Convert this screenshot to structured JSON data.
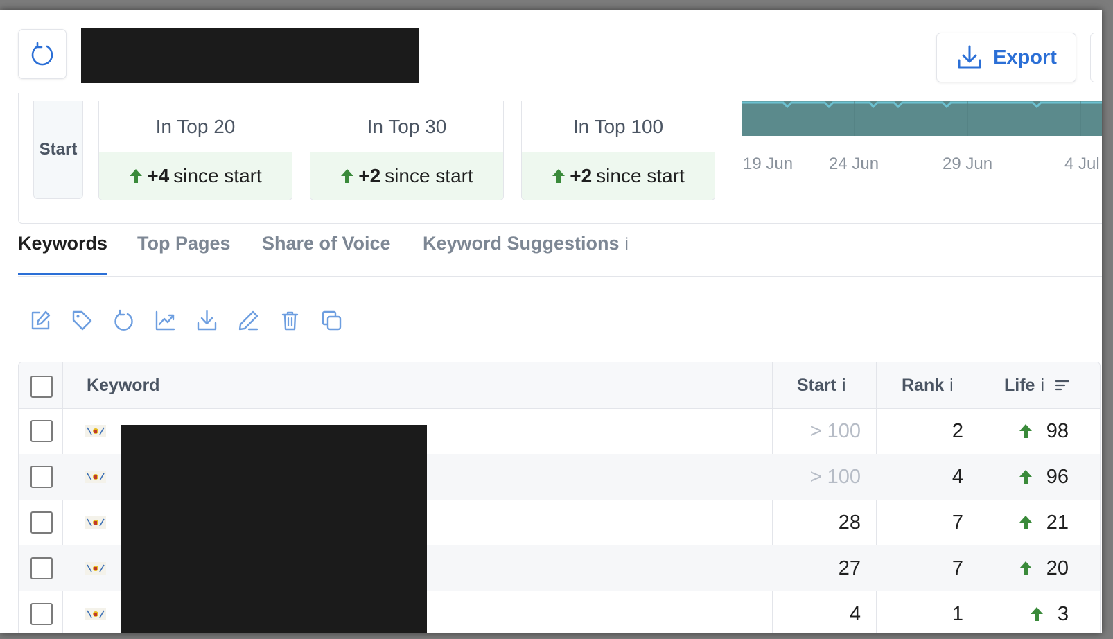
{
  "header": {
    "refresh_icon": "refresh-icon",
    "export_label": "Export",
    "export_icon": "download-icon"
  },
  "stats": {
    "start_label": "Start",
    "tiles": [
      {
        "title": "In Top 20",
        "delta": "+4",
        "suffix": "since start"
      },
      {
        "title": "In Top 30",
        "delta": "+2",
        "suffix": "since start"
      },
      {
        "title": "In Top 100",
        "delta": "+2",
        "suffix": "since start"
      }
    ]
  },
  "chart_data": {
    "type": "area",
    "x_ticks": [
      "19 Jun",
      "24 Jun",
      "29 Jun",
      "4 Jul"
    ],
    "colors": {
      "fill": "#5b8a8c",
      "line": "#6cc1d1"
    }
  },
  "tabs": [
    {
      "label": "Keywords",
      "active": true
    },
    {
      "label": "Top Pages",
      "active": false
    },
    {
      "label": "Share of Voice",
      "active": false
    },
    {
      "label": "Keyword Suggestions",
      "active": false,
      "info": "i"
    }
  ],
  "toolbar": [
    "edit-icon",
    "tag-icon",
    "refresh-icon",
    "chart-icon",
    "download-icon",
    "pencil-icon",
    "trash-icon",
    "copy-icon"
  ],
  "table": {
    "columns": {
      "keyword": "Keyword",
      "start": "Start",
      "start_info": "i",
      "rank": "Rank",
      "rank_info": "i",
      "life": "Life",
      "life_info": "i"
    },
    "rows": [
      {
        "start": "> 100",
        "start_muted": true,
        "rank": "2",
        "life": "98"
      },
      {
        "start": "> 100",
        "start_muted": true,
        "rank": "4",
        "life": "96"
      },
      {
        "start": "28",
        "start_muted": false,
        "rank": "7",
        "life": "21"
      },
      {
        "start": "27",
        "start_muted": false,
        "rank": "7",
        "life": "20"
      },
      {
        "start": "4",
        "start_muted": false,
        "rank": "1",
        "life": "3"
      }
    ]
  },
  "colors": {
    "accent": "#2b6fd6",
    "up_arrow": "#3a8a3a",
    "tile_green": "#eef8ef"
  }
}
